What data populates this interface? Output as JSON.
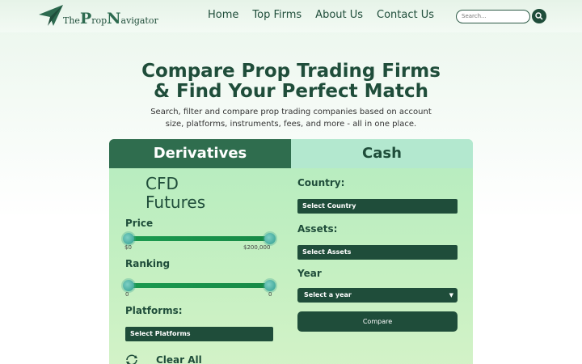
{
  "logo": {
    "part1": "The",
    "letter1": "P",
    "part2": "rop",
    "letter2": "N",
    "part3": "avigator"
  },
  "nav": {
    "links": [
      "Home",
      "Top Firms",
      "About Us",
      "Contact Us"
    ]
  },
  "search": {
    "placeholder": "Search..."
  },
  "hero": {
    "title_line1": "Compare Prop Trading Firms",
    "title_line2": "& Find Your Perfect Match",
    "subtitle": "Search, filter and compare prop trading companies based on account size, platforms, instruments, fees, and more -  all in one place."
  },
  "tabs": {
    "derivatives": "Derivatives",
    "cash": "Cash"
  },
  "categories": [
    "CFD",
    "Futures"
  ],
  "price": {
    "label": "Price",
    "min_label": "$0",
    "max_label": "$200,000",
    "range": [
      0,
      1
    ]
  },
  "ranking": {
    "label": "Ranking",
    "min_label": "0",
    "max_label": "0",
    "range": [
      0,
      1
    ]
  },
  "platforms": {
    "label": "Platforms:",
    "select": "Select Platforms"
  },
  "country": {
    "label": "Country:",
    "select": "Select Country"
  },
  "assets": {
    "label": "Assets:",
    "select": "Select Assets"
  },
  "year": {
    "label": "Year",
    "select": "Select a year"
  },
  "actions": {
    "compare": "Compare",
    "clear_all": "Clear All"
  },
  "colors": {
    "brand_dark": "#1f4d3a",
    "tab_active": "#2f6d4e",
    "tab_inactive": "#b3e8cf",
    "slider": "#1a9a4f"
  }
}
